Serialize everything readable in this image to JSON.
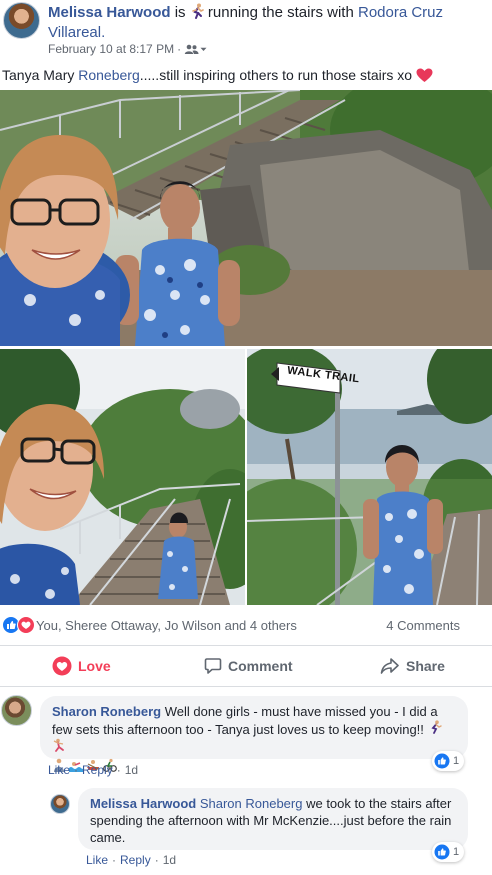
{
  "post": {
    "author": "Melissa Harwood",
    "is_label": "is",
    "activity": "running the stairs with",
    "tagged": "Rodora Cruz Villareal.",
    "timestamp": "February 10 at 8:17 PM",
    "separator": "·",
    "text": "Tanya Mary",
    "text_mention": "Roneberg",
    "text_rest": ".....still inspiring others to run those stairs xo"
  },
  "photos": {
    "sign_text": "WALK TRAIL"
  },
  "reactions": {
    "names": "You, Sheree Ottaway, Jo Wilson and 4 others",
    "comments_count": "4 Comments"
  },
  "actions": {
    "love": "Love",
    "comment": "Comment",
    "share": "Share"
  },
  "comments": [
    {
      "author": "Sharon Roneberg",
      "text": "Well done girls - must have missed you - I did a few sets this afternoon too - Tanya just loves us to keep moving!!",
      "like": "Like",
      "reply": "Reply",
      "sep": "·",
      "age": "1d",
      "reaction_count": "1"
    },
    {
      "author": "Melissa Harwood",
      "mention": "Sharon Roneberg",
      "text": "we took to the stairs after spending the afternoon with Mr McKenzie....just before the rain came.",
      "like": "Like",
      "reply": "Reply",
      "sep": "·",
      "age": "1d",
      "reaction_count": "1"
    }
  ],
  "colors": {
    "link": "#385898",
    "love": "#f33e58",
    "like": "#1877f2",
    "bubble": "#f2f3f5"
  },
  "icons": {
    "runner": "runner-emoji-icon",
    "audience": "friends-icon",
    "heart": "heart-emoji-icon",
    "like": "like-reaction-icon",
    "love": "love-reaction-icon",
    "comment": "comment-icon",
    "share": "share-icon"
  }
}
